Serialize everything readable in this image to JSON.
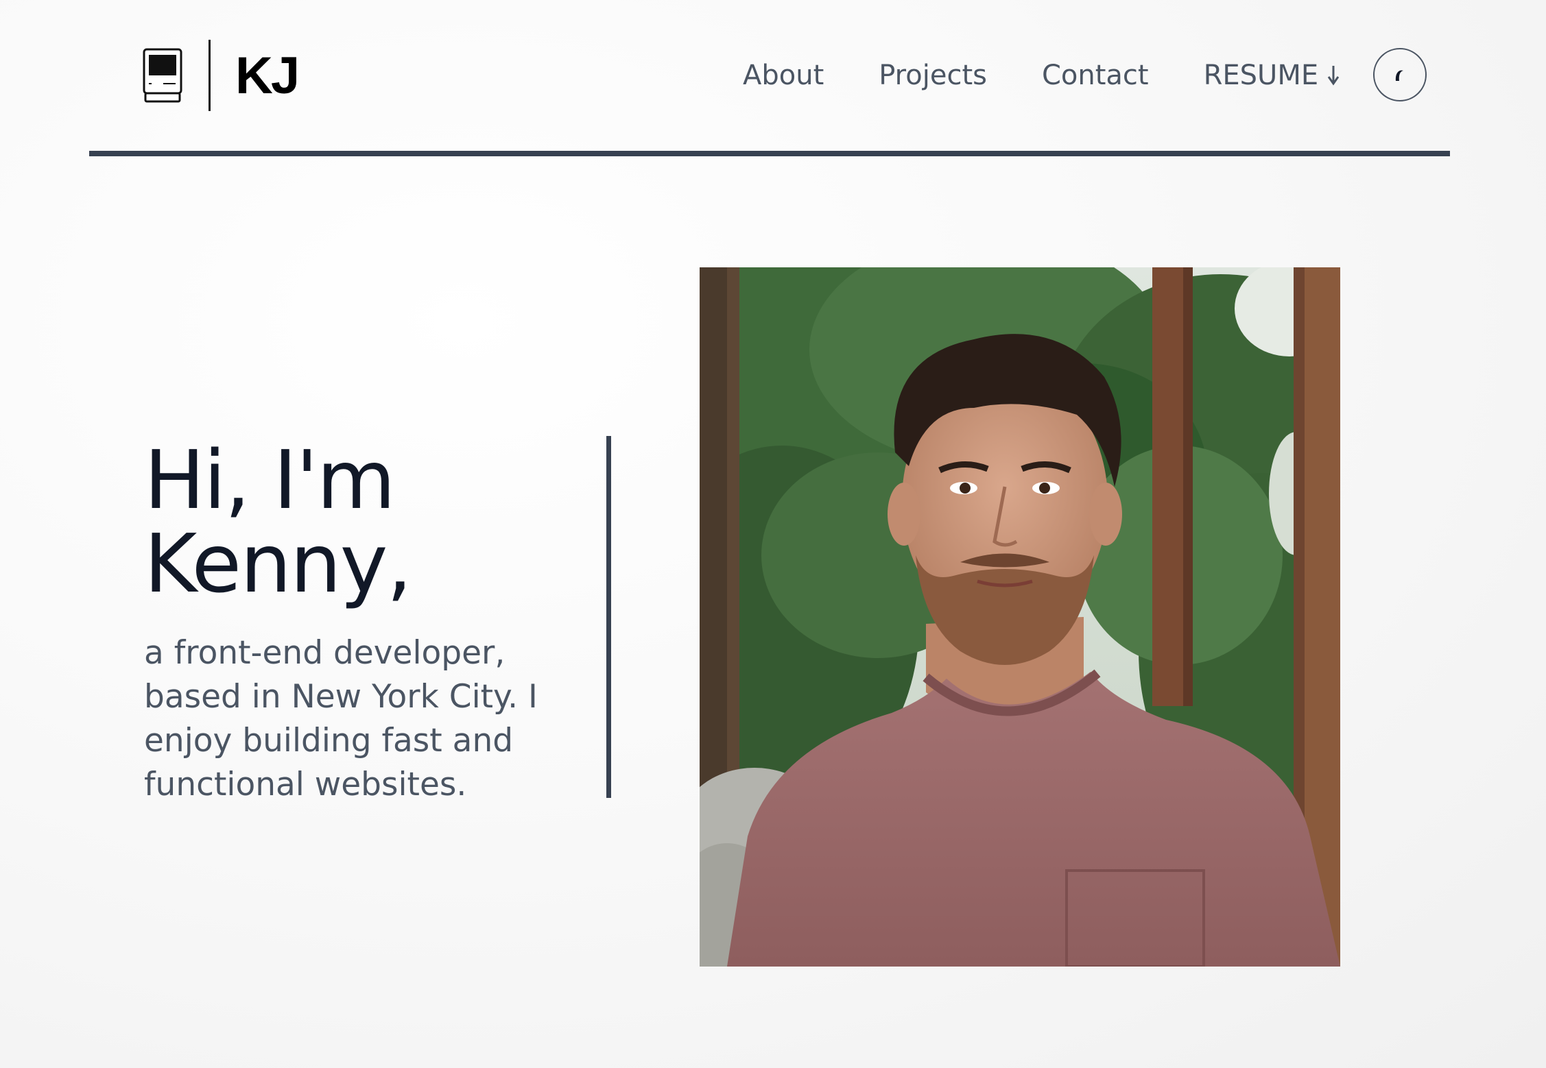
{
  "header": {
    "logo_text": "KJ",
    "logo_icon": "computer-icon",
    "nav": {
      "about": "About",
      "projects": "Projects",
      "contact": "Contact",
      "resume": "RESUME"
    },
    "resume_icon": "arrow-down-icon",
    "theme_toggle_icon": "moon-icon"
  },
  "hero": {
    "heading_line1": "Hi, I'm",
    "heading_line2": "Kenny,",
    "subtitle": "a front-end developer, based in New York City. I enjoy building fast and functional websites.",
    "photo_alt": "Kenny"
  },
  "colors": {
    "accent_dark": "#374151",
    "text_primary": "#111827",
    "text_secondary": "#4b5563"
  }
}
